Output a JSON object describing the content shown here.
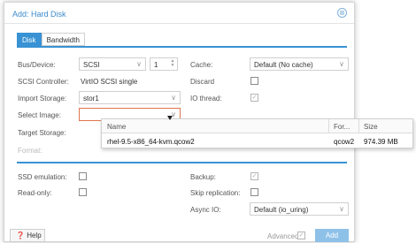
{
  "dialog": {
    "title": "Add: Hard Disk",
    "close_glyph": "⊗",
    "tabs": [
      {
        "label": "Disk",
        "active": true
      },
      {
        "label": "Bandwidth",
        "active": false
      }
    ]
  },
  "form": {
    "bus_device": {
      "label": "Bus/Device:",
      "bus": "SCSI",
      "device": "1"
    },
    "scsi_controller": {
      "label": "SCSI Controller:",
      "value": "VirtIO SCSI single"
    },
    "import_storage": {
      "label": "Import Storage:",
      "value": "stor1"
    },
    "select_image": {
      "label": "Select Image:",
      "value": ""
    },
    "target_storage": {
      "label": "Target Storage:"
    },
    "format": {
      "label": "Format:"
    },
    "cache": {
      "label": "Cache:",
      "value": "Default (No cache)"
    },
    "discard": {
      "label": "Discard",
      "checked": false
    },
    "io_thread": {
      "label": "IO thread:",
      "checked": true
    },
    "ssd_emulation": {
      "label": "SSD emulation:",
      "checked": false
    },
    "read_only": {
      "label": "Read-only:",
      "checked": false
    },
    "backup": {
      "label": "Backup:",
      "checked": true
    },
    "skip_replication": {
      "label": "Skip replication:",
      "checked": false
    },
    "async_io": {
      "label": "Async IO:",
      "value": "Default (io_uring)"
    }
  },
  "dropdown": {
    "columns": [
      "Name",
      "For...",
      "Size"
    ],
    "rows": [
      {
        "name": "rhel-9.5-x86_64-kvm.qcow2",
        "format": "qcow2",
        "size": "974.39 MB"
      }
    ]
  },
  "footer": {
    "help_label": "Help",
    "help_icon": "question-circle-icon",
    "advanced_label": "Advanced",
    "advanced_checked": true,
    "add_label": "Add"
  },
  "colors": {
    "accent": "#3892d4",
    "title": "#3c8acb",
    "invalid_border": "#e0744c"
  }
}
